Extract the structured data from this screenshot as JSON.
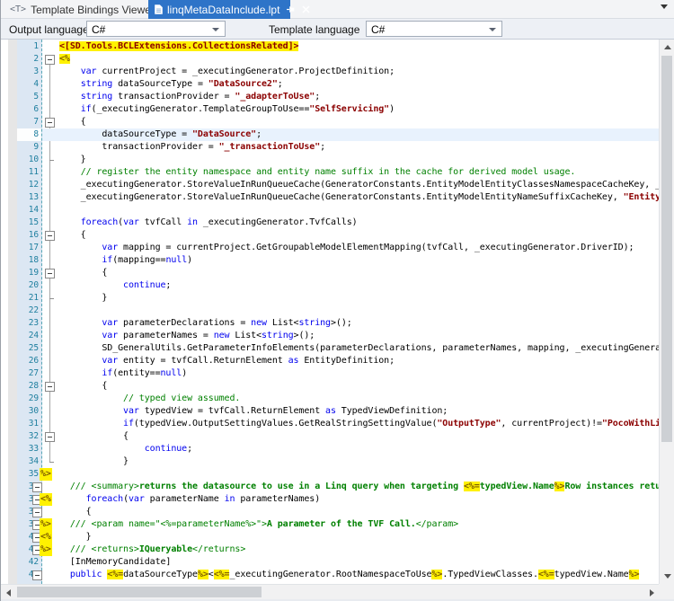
{
  "tab_bar": {
    "tabs": [
      {
        "label": "Template Bindings Viewer",
        "icon": "<T>",
        "active": false
      },
      {
        "label": "linqMetaDataInclude.lpt",
        "icon": "document",
        "active": true
      }
    ]
  },
  "toolbar": {
    "output_language_label": "Output language",
    "output_language_value": "C#",
    "template_language_label": "Template language",
    "template_language_value": "C#"
  },
  "editor": {
    "current_line": 8,
    "colors": {
      "keyword": "#0000EE",
      "string": "#8B0000",
      "comment": "#008000",
      "template_highlight_bg": "#FFF100",
      "template_token": "#806000",
      "line_number": "#1F7F9F",
      "active_tab": "#2E74C8",
      "current_line_bg": "#E8F2FD"
    },
    "lines": [
      {
        "n": 1,
        "fold": "",
        "tok": "",
        "seg": [
          [
            "yr",
            "<[SD.Tools.BCLExtensions.CollectionsRelated]>"
          ]
        ]
      },
      {
        "n": 2,
        "fold": "box",
        "tok": "",
        "seg": [
          [
            "y",
            "<%"
          ]
        ]
      },
      {
        "n": 3,
        "fold": "",
        "tok": "",
        "seg": [
          [
            "t",
            "    "
          ],
          [
            "k",
            "var"
          ],
          [
            "t",
            " currentProject = _executingGenerator.ProjectDefinition;"
          ]
        ]
      },
      {
        "n": 4,
        "fold": "",
        "tok": "",
        "seg": [
          [
            "t",
            "    "
          ],
          [
            "k",
            "string"
          ],
          [
            "t",
            " dataSourceType = "
          ],
          [
            "s",
            "\"DataSource2\""
          ],
          [
            "t",
            ";"
          ]
        ]
      },
      {
        "n": 5,
        "fold": "",
        "tok": "",
        "seg": [
          [
            "t",
            "    "
          ],
          [
            "k",
            "string"
          ],
          [
            "t",
            " transactionProvider = "
          ],
          [
            "s",
            "\"_adapterToUse\""
          ],
          [
            "t",
            ";"
          ]
        ]
      },
      {
        "n": 6,
        "fold": "",
        "tok": "",
        "seg": [
          [
            "t",
            "    "
          ],
          [
            "k",
            "if"
          ],
          [
            "t",
            "(_executingGenerator.TemplateGroupToUse=="
          ],
          [
            "s",
            "\"SelfServicing\""
          ],
          [
            "t",
            ")"
          ]
        ]
      },
      {
        "n": 7,
        "fold": "box",
        "tok": "",
        "seg": [
          [
            "t",
            "    {"
          ]
        ]
      },
      {
        "n": 8,
        "fold": "",
        "tok": "",
        "seg": [
          [
            "t",
            "        dataSourceType = "
          ],
          [
            "s",
            "\"DataSource\""
          ],
          [
            "t",
            ";"
          ]
        ]
      },
      {
        "n": 9,
        "fold": "",
        "tok": "",
        "seg": [
          [
            "t",
            "        transactionProvider = "
          ],
          [
            "s",
            "\"_transactionToUse\""
          ],
          [
            "t",
            ";"
          ]
        ]
      },
      {
        "n": 10,
        "fold": "tick",
        "tok": "",
        "seg": [
          [
            "t",
            "    }"
          ]
        ]
      },
      {
        "n": 11,
        "fold": "",
        "tok": "",
        "seg": [
          [
            "t",
            "    "
          ],
          [
            "c",
            "// register the entity namespace and entity name suffix in the cache for derived model usage."
          ]
        ]
      },
      {
        "n": 12,
        "fold": "",
        "tok": "",
        "seg": [
          [
            "t",
            "    _executingGenerator.StoreValueInRunQueueCache(GeneratorConstants.EntityModelEntityClassesNamespaceCacheKey, _executingGenerator"
          ]
        ]
      },
      {
        "n": 13,
        "fold": "",
        "tok": "",
        "seg": [
          [
            "t",
            "    _executingGenerator.StoreValueInRunQueueCache(GeneratorConstants.EntityModelEntityNameSuffixCacheKey, "
          ],
          [
            "s",
            "\"Entity\""
          ],
          [
            "t",
            ");"
          ]
        ]
      },
      {
        "n": 14,
        "fold": "",
        "tok": "",
        "seg": []
      },
      {
        "n": 15,
        "fold": "",
        "tok": "",
        "seg": [
          [
            "t",
            "    "
          ],
          [
            "k",
            "foreach"
          ],
          [
            "t",
            "("
          ],
          [
            "k",
            "var"
          ],
          [
            "t",
            " tvfCall "
          ],
          [
            "k",
            "in"
          ],
          [
            "t",
            " _executingGenerator.TvfCalls)"
          ]
        ]
      },
      {
        "n": 16,
        "fold": "box",
        "tok": "",
        "seg": [
          [
            "t",
            "    {"
          ]
        ]
      },
      {
        "n": 17,
        "fold": "",
        "tok": "",
        "seg": [
          [
            "t",
            "        "
          ],
          [
            "k",
            "var"
          ],
          [
            "t",
            " mapping = currentProject.GetGroupableModelElementMapping(tvfCall, _executingGenerator.DriverID);"
          ]
        ]
      },
      {
        "n": 18,
        "fold": "",
        "tok": "",
        "seg": [
          [
            "t",
            "        "
          ],
          [
            "k",
            "if"
          ],
          [
            "t",
            "(mapping=="
          ],
          [
            "k",
            "null"
          ],
          [
            "t",
            ")"
          ]
        ]
      },
      {
        "n": 19,
        "fold": "box",
        "tok": "",
        "seg": [
          [
            "t",
            "        {"
          ]
        ]
      },
      {
        "n": 20,
        "fold": "",
        "tok": "",
        "seg": [
          [
            "t",
            "            "
          ],
          [
            "k",
            "continue"
          ],
          [
            "t",
            ";"
          ]
        ]
      },
      {
        "n": 21,
        "fold": "tick",
        "tok": "",
        "seg": [
          [
            "t",
            "        }"
          ]
        ]
      },
      {
        "n": 22,
        "fold": "",
        "tok": "",
        "seg": []
      },
      {
        "n": 23,
        "fold": "",
        "tok": "",
        "seg": [
          [
            "t",
            "        "
          ],
          [
            "k",
            "var"
          ],
          [
            "t",
            " parameterDeclarations = "
          ],
          [
            "k",
            "new"
          ],
          [
            "t",
            " List<"
          ],
          [
            "k",
            "string"
          ],
          [
            "t",
            ">();"
          ]
        ]
      },
      {
        "n": 24,
        "fold": "",
        "tok": "",
        "seg": [
          [
            "t",
            "        "
          ],
          [
            "k",
            "var"
          ],
          [
            "t",
            " parameterNames = "
          ],
          [
            "k",
            "new"
          ],
          [
            "t",
            " List<"
          ],
          [
            "k",
            "string"
          ],
          [
            "t",
            ">();"
          ]
        ]
      },
      {
        "n": 25,
        "fold": "",
        "tok": "",
        "seg": [
          [
            "t",
            "        SD_GeneralUtils.GetParameterInfoElements(parameterDeclarations, parameterNames, mapping, _executingGenerator);"
          ]
        ]
      },
      {
        "n": 26,
        "fold": "",
        "tok": "",
        "seg": [
          [
            "t",
            "        "
          ],
          [
            "k",
            "var"
          ],
          [
            "t",
            " entity = tvfCall.ReturnElement "
          ],
          [
            "k",
            "as"
          ],
          [
            "t",
            " EntityDefinition;"
          ]
        ]
      },
      {
        "n": 27,
        "fold": "",
        "tok": "",
        "seg": [
          [
            "t",
            "        "
          ],
          [
            "k",
            "if"
          ],
          [
            "t",
            "(entity=="
          ],
          [
            "k",
            "null"
          ],
          [
            "t",
            ")"
          ]
        ]
      },
      {
        "n": 28,
        "fold": "box",
        "tok": "",
        "seg": [
          [
            "t",
            "        {"
          ]
        ]
      },
      {
        "n": 29,
        "fold": "",
        "tok": "",
        "seg": [
          [
            "t",
            "            "
          ],
          [
            "c",
            "// typed view assumed."
          ]
        ]
      },
      {
        "n": 30,
        "fold": "",
        "tok": "",
        "seg": [
          [
            "t",
            "            "
          ],
          [
            "k",
            "var"
          ],
          [
            "t",
            " typedView = tvfCall.ReturnElement "
          ],
          [
            "k",
            "as"
          ],
          [
            "t",
            " TypedViewDefinition;"
          ]
        ]
      },
      {
        "n": 31,
        "fold": "",
        "tok": "",
        "seg": [
          [
            "t",
            "            "
          ],
          [
            "k",
            "if"
          ],
          [
            "t",
            "(typedView.OutputSettingValues.GetRealStringSettingValue("
          ],
          [
            "s",
            "\"OutputType\""
          ],
          [
            "t",
            ", currentProject)!="
          ],
          [
            "s",
            "\"PocoWithLinq"
          ]
        ]
      },
      {
        "n": 32,
        "fold": "box",
        "tok": "",
        "seg": [
          [
            "t",
            "            {"
          ]
        ]
      },
      {
        "n": 33,
        "fold": "",
        "tok": "",
        "seg": [
          [
            "t",
            "                "
          ],
          [
            "k",
            "continue"
          ],
          [
            "t",
            ";"
          ]
        ]
      },
      {
        "n": 34,
        "fold": "tick",
        "tok": "",
        "seg": [
          [
            "t",
            "            }"
          ]
        ]
      },
      {
        "n": 35,
        "fold": "",
        "tok": "%>",
        "seg": []
      },
      {
        "n": 36,
        "fold": "box2",
        "tok": "",
        "seg": [
          [
            "t",
            "  "
          ],
          [
            "c",
            "/// <summary>"
          ],
          [
            "cb",
            "returns the datasource to use in a Linq query when targeting "
          ],
          [
            "y",
            "<%="
          ],
          [
            "cb",
            "typedView.Name"
          ],
          [
            "y",
            "%>"
          ],
          [
            "cb",
            "Row instances returned"
          ]
        ]
      },
      {
        "n": 37,
        "fold": "box2",
        "tok": "<%",
        "seg": [
          [
            "t",
            "     "
          ],
          [
            "k",
            "foreach"
          ],
          [
            "t",
            "("
          ],
          [
            "k",
            "var"
          ],
          [
            "t",
            " parameterName "
          ],
          [
            "k",
            "in"
          ],
          [
            "t",
            " parameterNames)"
          ]
        ]
      },
      {
        "n": 38,
        "fold": "box2",
        "tok": "",
        "seg": [
          [
            "t",
            "     {"
          ]
        ]
      },
      {
        "n": 39,
        "fold": "box2",
        "tok": "%>",
        "seg": [
          [
            "t",
            "  "
          ],
          [
            "c",
            "/// <param name=\"<%=parameterName%>\">"
          ],
          [
            "cb",
            "A parameter of the TVF Call."
          ],
          [
            "c",
            "</param>"
          ]
        ]
      },
      {
        "n": 40,
        "fold": "box2",
        "tok": "<%",
        "seg": [
          [
            "t",
            "     }"
          ]
        ]
      },
      {
        "n": 41,
        "fold": "box2",
        "tok": "%>",
        "seg": [
          [
            "t",
            "  "
          ],
          [
            "c",
            "/// <returns>"
          ],
          [
            "cb",
            "IQueryable"
          ],
          [
            "c",
            "</returns>"
          ]
        ]
      },
      {
        "n": 42,
        "fold": "",
        "tok": "",
        "seg": [
          [
            "t",
            "  [InMemoryCandidate]"
          ]
        ]
      },
      {
        "n": 43,
        "fold": "box2",
        "tok": "",
        "seg": [
          [
            "t",
            "  "
          ],
          [
            "k",
            "public"
          ],
          [
            "t",
            " "
          ],
          [
            "y",
            "<%="
          ],
          [
            "t",
            "dataSourceType"
          ],
          [
            "y",
            "%>"
          ],
          [
            "t",
            "<"
          ],
          [
            "y",
            "<%="
          ],
          [
            "t",
            "_executingGenerator.RootNamespaceToUse"
          ],
          [
            "y",
            "%>"
          ],
          [
            "t",
            ".TypedViewClasses."
          ],
          [
            "y",
            "<%="
          ],
          [
            "t",
            "typedView.Name"
          ],
          [
            "y",
            "%>"
          ]
        ]
      }
    ]
  }
}
